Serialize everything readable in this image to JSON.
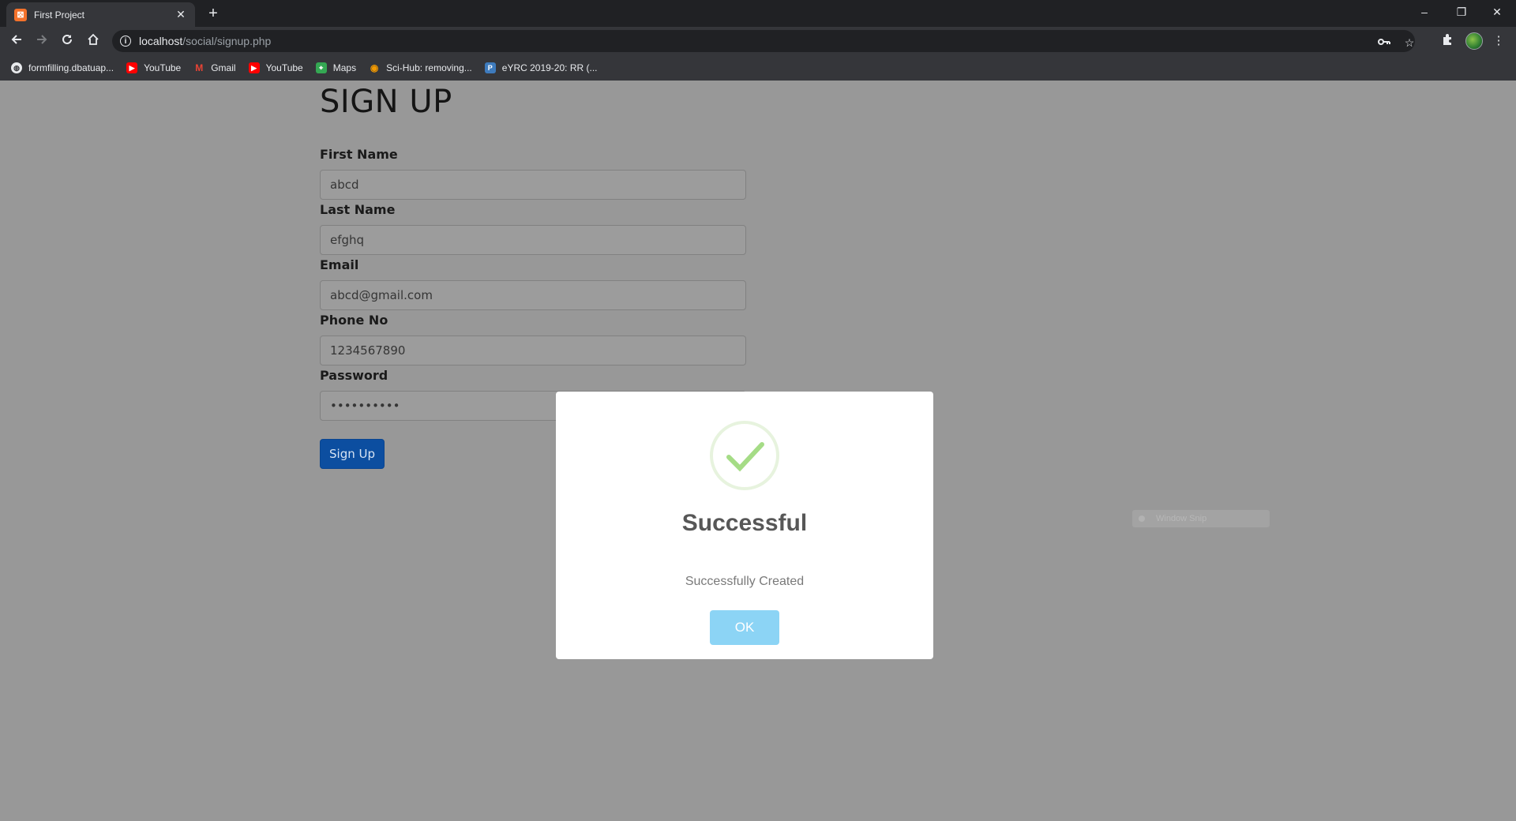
{
  "browser": {
    "tab_title": "First Project",
    "tab_close": "✕",
    "new_tab": "+",
    "url_host": "localhost",
    "url_path": "/social/signup.php",
    "window_controls": {
      "minimize": "–",
      "restore": "❐",
      "close": "✕"
    },
    "bookmarks": [
      {
        "label": "formfilling.dbatuap...",
        "icon": "globe-icon",
        "color": "#e8eaed"
      },
      {
        "label": "YouTube",
        "icon": "youtube-icon",
        "color": "#ff0000"
      },
      {
        "label": "Gmail",
        "icon": "gmail-icon",
        "color": "#ea4335"
      },
      {
        "label": "YouTube",
        "icon": "youtube-icon",
        "color": "#ff0000"
      },
      {
        "label": "Maps",
        "icon": "maps-icon",
        "color": "#34a853"
      },
      {
        "label": "Sci-Hub: removing...",
        "icon": "scihub-icon",
        "color": "#f29900"
      },
      {
        "label": "eYRC 2019-20: RR (...",
        "icon": "piazza-icon",
        "color": "#3e7bbd"
      }
    ]
  },
  "page": {
    "title": "SIGN UP",
    "fields": [
      {
        "label": "First Name",
        "value": "abcd"
      },
      {
        "label": "Last Name",
        "value": "efghq"
      },
      {
        "label": "Email",
        "value": "abcd@gmail.com"
      },
      {
        "label": "Phone No",
        "value": "1234567890"
      },
      {
        "label": "Password",
        "value": "••••••••••"
      }
    ],
    "submit_label": "Sign Up",
    "snip_label": "Window Snip"
  },
  "modal": {
    "title": "Successful",
    "message": "Successfully Created",
    "ok_label": "OK",
    "check_color": "#a5dc86"
  }
}
